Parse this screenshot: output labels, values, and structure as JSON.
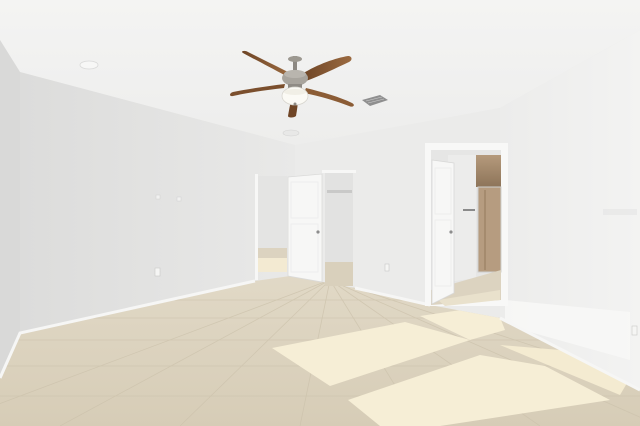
{
  "scene": {
    "subject": "empty-bedroom-interior",
    "elements": [
      "ceiling",
      "ceiling-fan",
      "ceiling-vent",
      "smoke-detector",
      "left-wall",
      "back-wall",
      "right-wall",
      "tile-floor",
      "closet-doorway",
      "closet-door",
      "bathroom-doorway",
      "bathroom-door",
      "wall-outlets",
      "sunlight-patches"
    ]
  },
  "colors": {
    "ceiling": "#f2f2f1",
    "wall_left": "#e4e4e3",
    "wall_back": "#ebebea",
    "wall_right": "#efefee",
    "floor_base": "#dcd3c0",
    "floor_grout": "#cfc5b1",
    "sunlight": "#f6eed6",
    "door": "#f7f7f6",
    "fan_blade": "#8a5a34",
    "fan_metal": "#9a9690",
    "shower_tile": "#a98f73"
  }
}
